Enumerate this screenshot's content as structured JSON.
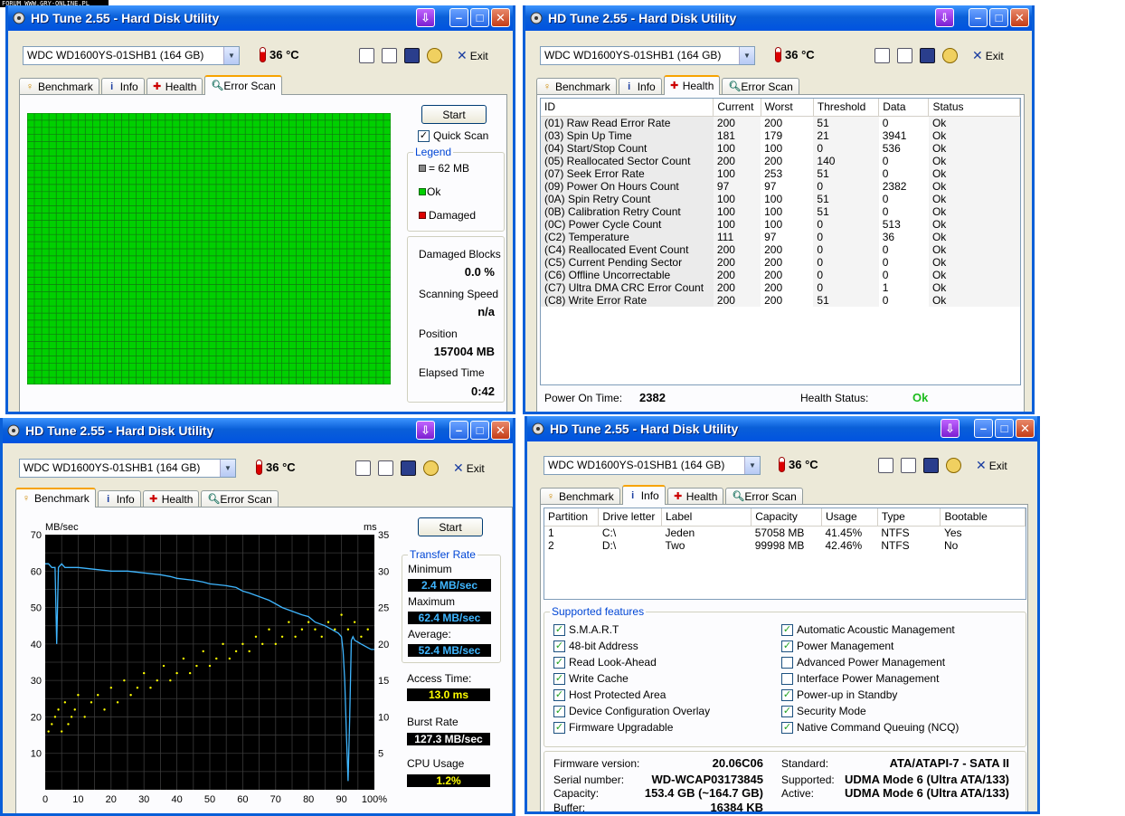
{
  "forum_banner": "FORUM WWW.GRY-ONLINE.PL",
  "window_title": "HD Tune 2.55 - Hard Disk Utility",
  "drive": "WDC WD1600YS-01SHB1 (164 GB)",
  "temperature": "36 °C",
  "exit_label": "Exit",
  "tabs": {
    "benchmark": "Benchmark",
    "info": "Info",
    "health": "Health",
    "error_scan": "Error Scan"
  },
  "start_label": "Start",
  "error_scan": {
    "quick_scan": "Quick Scan",
    "legend_title": "Legend",
    "legend_block": "= 62 MB",
    "legend_ok": "Ok",
    "legend_damaged": "Damaged",
    "damaged_blocks_label": "Damaged Blocks",
    "damaged_blocks_value": "0.0 %",
    "scanning_speed_label": "Scanning Speed",
    "scanning_speed_value": "n/a",
    "position_label": "Position",
    "position_value": "157004 MB",
    "elapsed_label": "Elapsed Time",
    "elapsed_value": "0:42",
    "colors": {
      "ok": "#00d000",
      "damaged": "#d00000",
      "grid_lines": "#107810"
    }
  },
  "health": {
    "columns": [
      "ID",
      "Current",
      "Worst",
      "Threshold",
      "Data",
      "Status"
    ],
    "rows": [
      [
        "(01) Raw Read Error Rate",
        "200",
        "200",
        "51",
        "0",
        "Ok"
      ],
      [
        "(03) Spin Up Time",
        "181",
        "179",
        "21",
        "3941",
        "Ok"
      ],
      [
        "(04) Start/Stop Count",
        "100",
        "100",
        "0",
        "536",
        "Ok"
      ],
      [
        "(05) Reallocated Sector Count",
        "200",
        "200",
        "140",
        "0",
        "Ok"
      ],
      [
        "(07) Seek Error Rate",
        "100",
        "253",
        "51",
        "0",
        "Ok"
      ],
      [
        "(09) Power On Hours Count",
        "97",
        "97",
        "0",
        "2382",
        "Ok"
      ],
      [
        "(0A) Spin Retry Count",
        "100",
        "100",
        "51",
        "0",
        "Ok"
      ],
      [
        "(0B) Calibration Retry Count",
        "100",
        "100",
        "51",
        "0",
        "Ok"
      ],
      [
        "(0C) Power Cycle Count",
        "100",
        "100",
        "0",
        "513",
        "Ok"
      ],
      [
        "(C2) Temperature",
        "111",
        "97",
        "0",
        "36",
        "Ok"
      ],
      [
        "(C4) Reallocated Event Count",
        "200",
        "200",
        "0",
        "0",
        "Ok"
      ],
      [
        "(C5) Current Pending Sector",
        "200",
        "200",
        "0",
        "0",
        "Ok"
      ],
      [
        "(C6) Offline Uncorrectable",
        "200",
        "200",
        "0",
        "0",
        "Ok"
      ],
      [
        "(C7) Ultra DMA CRC Error Count",
        "200",
        "200",
        "0",
        "1",
        "Ok"
      ],
      [
        "(C8) Write Error Rate",
        "200",
        "200",
        "51",
        "0",
        "Ok"
      ]
    ],
    "power_on_label": "Power On Time:",
    "power_on_value": "2382",
    "health_status_label": "Health Status:",
    "health_status_value": "Ok"
  },
  "benchmark": {
    "y_left_unit": "MB/sec",
    "y_right_unit": "ms",
    "transfer_rate_title": "Transfer Rate",
    "minimum_label": "Minimum",
    "minimum_value": "2.4 MB/sec",
    "maximum_label": "Maximum",
    "maximum_value": "62.4 MB/sec",
    "average_label": "Average:",
    "average_value": "52.4 MB/sec",
    "access_time_label": "Access Time:",
    "access_time_value": "13.0 ms",
    "burst_rate_label": "Burst Rate",
    "burst_rate_value": "127.3 MB/sec",
    "cpu_usage_label": "CPU Usage",
    "cpu_usage_value": "1.2%"
  },
  "chart_data": {
    "type": "line",
    "xlabel": "",
    "ylabel": "MB/sec",
    "y2label": "ms",
    "x_ticks": [
      "0",
      "10",
      "20",
      "30",
      "40",
      "50",
      "60",
      "70",
      "80",
      "90",
      "100%"
    ],
    "y_ticks_left": [
      "10",
      "20",
      "30",
      "40",
      "50",
      "60",
      "70"
    ],
    "y_ticks_right": [
      "5",
      "10",
      "15",
      "20",
      "25",
      "30",
      "35"
    ],
    "xlim": [
      0,
      100
    ],
    "ylim": [
      0,
      70
    ],
    "y2lim": [
      0,
      35
    ],
    "grid": true,
    "series": [
      {
        "name": "Transfer Rate",
        "color": "#3fb6ff",
        "x": [
          0,
          1,
          2,
          3,
          3.5,
          4,
          5,
          6,
          8,
          10,
          15,
          20,
          25,
          30,
          35,
          38,
          40,
          45,
          48,
          50,
          55,
          58,
          60,
          62,
          65,
          68,
          70,
          72,
          75,
          78,
          80,
          82,
          85,
          86,
          87,
          88,
          89,
          90,
          90.5,
          91,
          91.5,
          92,
          92.5,
          93,
          93.5,
          94,
          95,
          96,
          97,
          98,
          99,
          100
        ],
        "y": [
          62,
          62,
          61,
          61,
          40,
          61,
          62,
          61,
          61,
          61,
          60.5,
          60,
          60,
          59.5,
          59,
          58.5,
          58,
          57.5,
          57,
          56.5,
          56,
          55.5,
          54.5,
          54,
          53,
          52,
          51,
          50,
          49,
          48,
          47.5,
          46,
          45,
          44.5,
          44,
          43.5,
          43,
          42,
          38,
          30,
          15,
          2.4,
          20,
          41,
          42,
          41,
          40.5,
          40,
          39.5,
          39,
          38.5,
          38.5
        ]
      },
      {
        "name": "Access Time",
        "color": "#ffff00",
        "type": "scatter",
        "x": [
          1,
          2,
          3,
          4,
          5,
          6,
          7,
          8,
          9,
          10,
          12,
          14,
          16,
          18,
          20,
          22,
          24,
          26,
          28,
          30,
          32,
          34,
          36,
          38,
          40,
          42,
          44,
          46,
          48,
          50,
          52,
          54,
          56,
          58,
          60,
          62,
          64,
          66,
          68,
          70,
          72,
          74,
          76,
          78,
          80,
          82,
          84,
          86,
          88,
          90,
          92,
          94,
          96,
          98
        ],
        "y": [
          8,
          9,
          10,
          11,
          8,
          12,
          9,
          10,
          11,
          13,
          10,
          12,
          13,
          11,
          14,
          12,
          15,
          13,
          14,
          16,
          14,
          15,
          17,
          15,
          16,
          18,
          16,
          17,
          19,
          17,
          18,
          20,
          18,
          19,
          20,
          19,
          21,
          20,
          22,
          20,
          21,
          23,
          21,
          22,
          23,
          22,
          21,
          23,
          22,
          24,
          22,
          23,
          21,
          22
        ]
      }
    ]
  },
  "info": {
    "columns": [
      "Partition",
      "Drive letter",
      "Label",
      "Capacity",
      "Usage",
      "Type",
      "Bootable"
    ],
    "rows": [
      [
        "1",
        "C:\\",
        "Jeden",
        "57058 MB",
        "41.45%",
        "NTFS",
        "Yes"
      ],
      [
        "2",
        "D:\\",
        "Two",
        "99998 MB",
        "42.46%",
        "NTFS",
        "No"
      ]
    ],
    "features_title": "Supported features",
    "features_left": [
      {
        "label": "S.M.A.R.T",
        "checked": true
      },
      {
        "label": "48-bit Address",
        "checked": true
      },
      {
        "label": "Read Look-Ahead",
        "checked": true
      },
      {
        "label": "Write Cache",
        "checked": true
      },
      {
        "label": "Host Protected Area",
        "checked": true
      },
      {
        "label": "Device Configuration Overlay",
        "checked": true
      },
      {
        "label": "Firmware Upgradable",
        "checked": true
      }
    ],
    "features_right": [
      {
        "label": "Automatic Acoustic Management",
        "checked": true
      },
      {
        "label": "Power Management",
        "checked": true
      },
      {
        "label": "Advanced Power Management",
        "checked": false
      },
      {
        "label": "Interface Power Management",
        "checked": false
      },
      {
        "label": "Power-up in Standby",
        "checked": true
      },
      {
        "label": "Security Mode",
        "checked": true
      },
      {
        "label": "Native Command Queuing (NCQ)",
        "checked": true
      }
    ],
    "firmware_label": "Firmware version:",
    "firmware_value": "20.06C06",
    "serial_label": "Serial number:",
    "serial_value": "WD-WCAP03173845",
    "capacity_label": "Capacity:",
    "capacity_value": "153.4 GB (~164.7 GB)",
    "buffer_label": "Buffer:",
    "buffer_value": "16384 KB",
    "standard_label": "Standard:",
    "standard_value": "ATA/ATAPI-7 - SATA II",
    "supported_label": "Supported:",
    "supported_value": "UDMA Mode 6 (Ultra ATA/133)",
    "active_label": "Active:",
    "active_value": "UDMA Mode 6 (Ultra ATA/133)"
  }
}
